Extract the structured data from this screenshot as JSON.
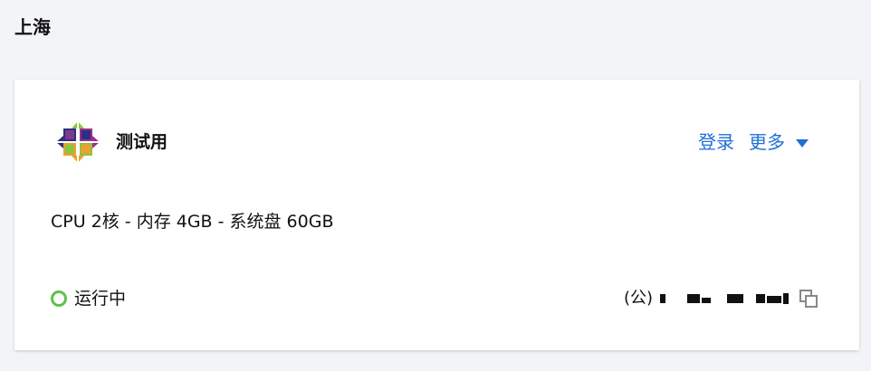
{
  "region": {
    "title": "上海"
  },
  "instance": {
    "name": "测试用",
    "os_icon": "centos-logo-icon",
    "specs": "CPU 2核 - 内存 4GB - 系统盘 60GB",
    "status": {
      "text": "运行中",
      "color": "#5cc24b"
    },
    "ip": {
      "label": "(公)"
    }
  },
  "actions": {
    "login_label": "登录",
    "more_label": "更多",
    "more_icon": "caret-down-icon",
    "copy_icon": "copy-icon"
  },
  "colors": {
    "link": "#1f6fd8",
    "background": "#f3f4f7",
    "card": "#ffffff"
  }
}
